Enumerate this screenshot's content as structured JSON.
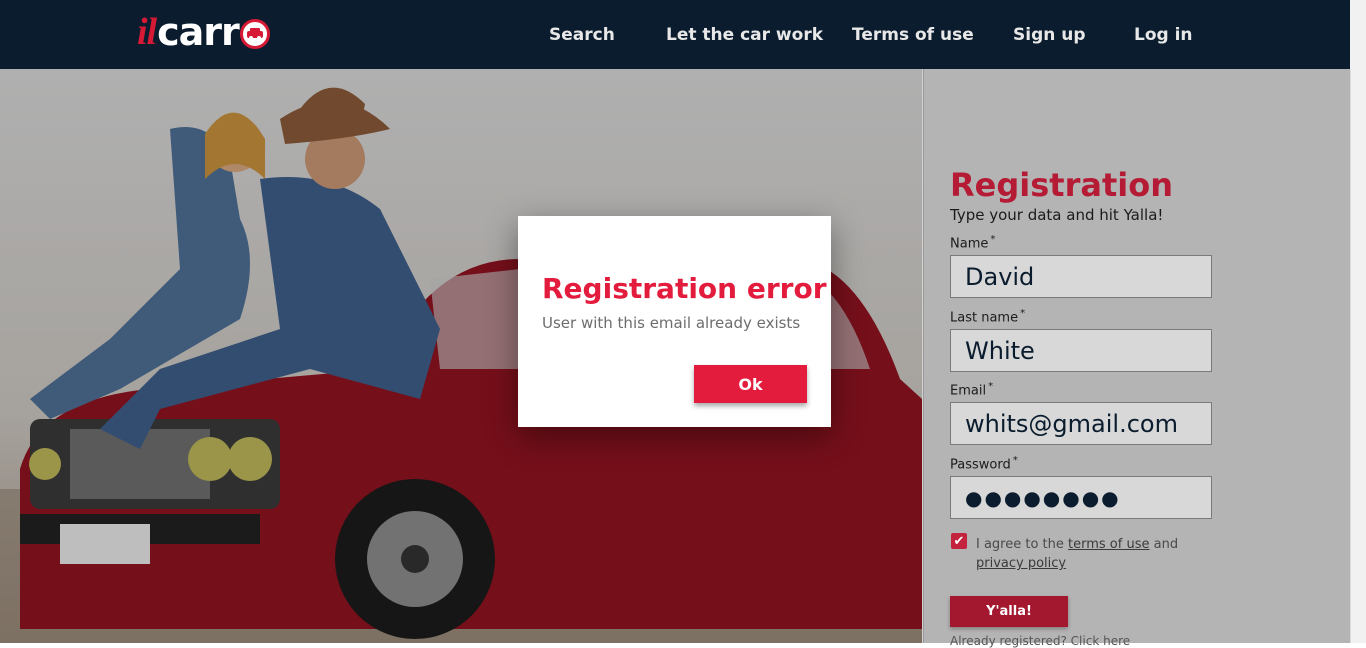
{
  "brand": {
    "logo_prefix": "il",
    "logo_text": "carr"
  },
  "nav": {
    "search": "Search",
    "let_car_work": "Let the car work",
    "terms": "Terms of use",
    "signup": "Sign up",
    "login": "Log in"
  },
  "registration": {
    "title": "Registration",
    "subtitle": "Type your data and hit Yalla!",
    "name_label": "Name",
    "name_value": "David",
    "lastname_label": "Last name",
    "lastname_value": "White",
    "email_label": "Email",
    "email_value": "whits@gmail.com",
    "password_label": "Password",
    "password_value": "●●●●●●●●",
    "required_mark": "*",
    "agree_prefix": "I agree to the",
    "agree_terms": "terms of use",
    "agree_and": "and",
    "agree_privacy": "privacy policy",
    "submit_label": "Y'alla!",
    "already_text": "Already registered? Click here"
  },
  "dialog": {
    "title": "Registration error",
    "message": "User with this email already exists",
    "ok_label": "Ok"
  },
  "colors": {
    "header_bg": "#0a1c2d",
    "accent": "#e31c3d",
    "brand_red": "#b51b34"
  }
}
